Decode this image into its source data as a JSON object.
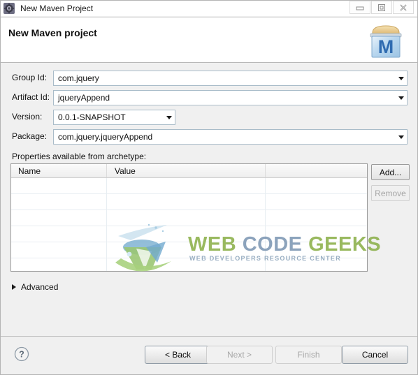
{
  "window": {
    "title": "New Maven Project",
    "app_icon": "eclipse-gear-icon",
    "controls": {
      "minimize": "minimize-icon",
      "maximize": "maximize-icon",
      "close": "close-icon"
    }
  },
  "header": {
    "title": "New Maven project",
    "logo_letter": "M",
    "logo_name": "maven-logo"
  },
  "form": {
    "fields": [
      {
        "label": "Group Id:",
        "value": "com.jquery",
        "has_dropdown": true,
        "name": "group-id"
      },
      {
        "label": "Artifact Id:",
        "value": "jqueryAppend",
        "has_dropdown": true,
        "name": "artifact-id"
      },
      {
        "label": "Version:",
        "value": "0.0.1-SNAPSHOT",
        "has_dropdown": true,
        "name": "version"
      },
      {
        "label": "Package:",
        "value": "com.jquery.jqueryAppend",
        "has_dropdown": true,
        "name": "package"
      }
    ]
  },
  "properties": {
    "section_label": "Properties available from archetype:",
    "columns": [
      "Name",
      "Value"
    ],
    "rows": [],
    "row_count": 7,
    "buttons": {
      "add": {
        "label": "Add...",
        "enabled": true
      },
      "remove": {
        "label": "Remove",
        "enabled": false
      }
    }
  },
  "advanced": {
    "label": "Advanced",
    "expanded": false,
    "icon": "triangle-right-icon"
  },
  "footer": {
    "help": {
      "icon": "help-question-icon",
      "label": "?"
    },
    "buttons": [
      {
        "label": "< Back",
        "enabled": true,
        "name": "back"
      },
      {
        "label": "Next >",
        "enabled": false,
        "name": "next"
      },
      {
        "label": "Finish",
        "enabled": false,
        "name": "finish"
      },
      {
        "label": "Cancel",
        "enabled": true,
        "name": "cancel"
      }
    ]
  },
  "watermark": {
    "word1": "WEB",
    "word2": "CODE",
    "word3": "GEEKS",
    "subtitle": "WEB DEVELOPERS RESOURCE CENTER",
    "color_green": "#8bb04a",
    "color_blue": "#7d97b3"
  },
  "colors": {
    "body_background": "#f0f0f0",
    "panel_white": "#ffffff",
    "input_border": "#a9bcc9",
    "maven_blue": "#2f6bb0",
    "maven_lid": "#e6c98a"
  }
}
